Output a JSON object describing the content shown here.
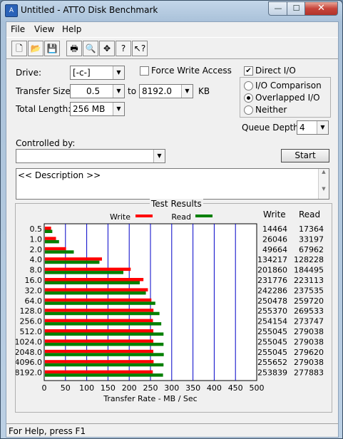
{
  "window": {
    "title": "Untitled - ATTO Disk Benchmark",
    "icon": "atto-app-icon"
  },
  "window_controls": {
    "minimize": "—",
    "maximize": "☐",
    "close": "✕"
  },
  "menu": [
    "File",
    "View",
    "Help"
  ],
  "toolbar": [
    "new-icon",
    "open-icon",
    "save-icon",
    "print-icon",
    "print-preview-icon",
    "move-icon",
    "help-icon",
    "context-help-icon"
  ],
  "drive": {
    "label": "Drive:",
    "value": "[-c-]"
  },
  "force_write_access": {
    "label": "Force Write Access",
    "checked": false
  },
  "direct_io": {
    "label": "Direct I/O",
    "checked": true
  },
  "transfer_size": {
    "label": "Transfer Size:",
    "from": "0.5",
    "to_label": "to",
    "to": "8192.0",
    "unit": "KB"
  },
  "total_length": {
    "label": "Total Length:",
    "value": "256 MB"
  },
  "io_mode": {
    "options": [
      "I/O Comparison",
      "Overlapped I/O",
      "Neither"
    ],
    "selected": "Overlapped I/O"
  },
  "queue_depth": {
    "label": "Queue Depth:",
    "value": "4"
  },
  "controlled_by": {
    "label": "Controlled by:",
    "value": ""
  },
  "start_button": "Start",
  "description": "<< Description >>",
  "results": {
    "title": "Test Results",
    "write_col": "Write",
    "read_col": "Read"
  },
  "chart_data": {
    "type": "bar",
    "orientation": "horizontal",
    "categories": [
      "0.5",
      "1.0",
      "2.0",
      "4.0",
      "8.0",
      "16.0",
      "32.0",
      "64.0",
      "128.0",
      "256.0",
      "512.0",
      "1024.0",
      "2048.0",
      "4096.0",
      "8192.0"
    ],
    "series": [
      {
        "name": "Write",
        "color": "#ff0000",
        "values": [
          14464,
          26046,
          49664,
          134217,
          201860,
          231776,
          242286,
          250478,
          255370,
          254154,
          255045,
          255045,
          255045,
          255652,
          253839
        ]
      },
      {
        "name": "Read",
        "color": "#008000",
        "values": [
          17364,
          33197,
          67962,
          128228,
          184495,
          223113,
          237535,
          259720,
          269533,
          273747,
          279038,
          279038,
          279620,
          279038,
          277883
        ]
      }
    ],
    "xlabel": "Transfer Rate - MB / Sec",
    "xticks": [
      "0",
      "50",
      "100",
      "150",
      "200",
      "250",
      "300",
      "350",
      "400",
      "450",
      "500"
    ],
    "xlim": [
      0,
      500
    ],
    "legend": "top",
    "grid": true
  },
  "status": "For Help, press F1"
}
